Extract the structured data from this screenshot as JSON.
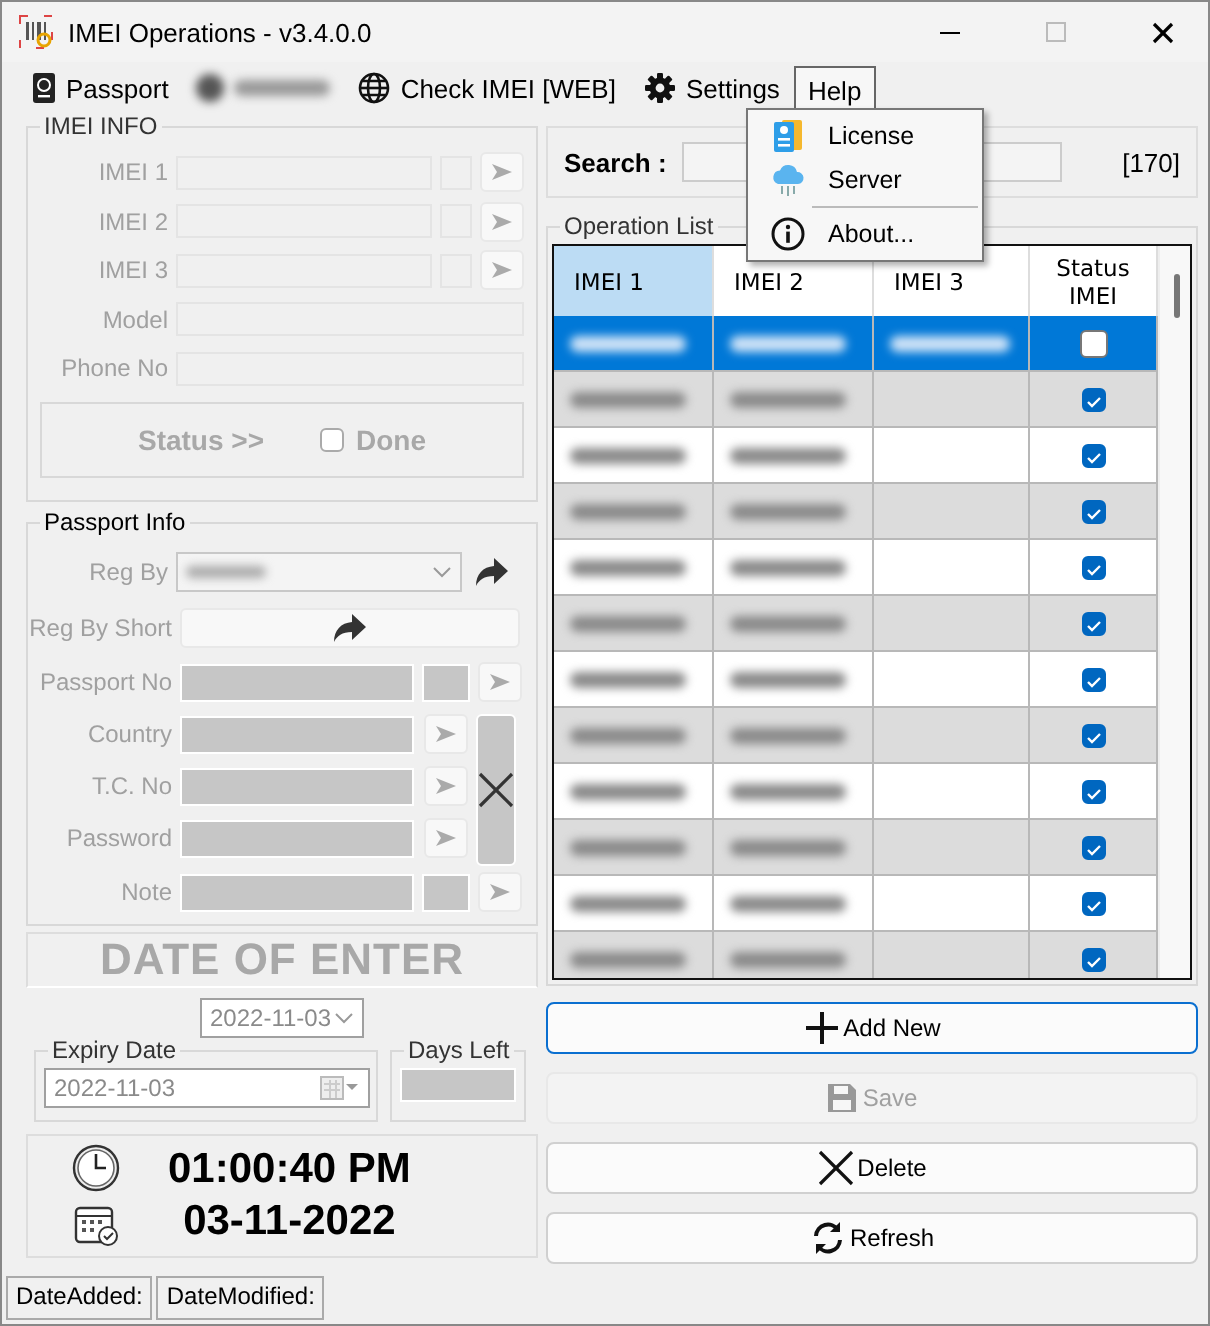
{
  "window": {
    "title": "IMEI Operations - v3.4.0.0"
  },
  "menu": [
    {
      "label": "Passport",
      "kind": "passport",
      "open": false
    },
    {
      "kind": "redacted",
      "open": false
    },
    {
      "label": "Check IMEI [WEB]",
      "kind": "globe",
      "open": false
    },
    {
      "label": "Settings",
      "kind": "gear",
      "open": false
    },
    {
      "label": "Help",
      "kind": "plain",
      "open": true
    }
  ],
  "help_menu": [
    {
      "label": "License",
      "kind": "license"
    },
    {
      "label": "Server",
      "kind": "cloud"
    },
    {
      "kind": "separator"
    },
    {
      "label": "About...",
      "kind": "info"
    }
  ],
  "imei_info": {
    "title": "IMEI INFO",
    "fields": [
      {
        "label": "IMEI 1",
        "kind": "imei"
      },
      {
        "label": "IMEI 2",
        "kind": "imei"
      },
      {
        "label": "IMEI 3",
        "kind": "imei"
      },
      {
        "label": "Model",
        "kind": "plain"
      },
      {
        "label": "Phone No",
        "kind": "plain"
      }
    ],
    "status_label": "Status >>",
    "done": {
      "label": "Done",
      "checked": false
    }
  },
  "passport_info": {
    "title": "Passport Info",
    "reg_by": {
      "label": "Reg By"
    },
    "reg_by_short": {
      "label": "Reg By Short"
    },
    "fields": [
      {
        "label": "Passport No",
        "kind": "split"
      },
      {
        "label": "Country",
        "kind": "clearable"
      },
      {
        "label": "T.C. No",
        "kind": "clearable"
      },
      {
        "label": "Password",
        "kind": "clearable"
      },
      {
        "label": "Note",
        "kind": "split"
      }
    ]
  },
  "date_of_enter": {
    "title": "DATE OF ENTER",
    "date": "2022-11-03"
  },
  "expiry_date": {
    "title": "Expiry Date",
    "date": "2022-11-03"
  },
  "days_left": {
    "title": "Days Left"
  },
  "clock": {
    "time": "01:00:40 PM",
    "date": "03-11-2022"
  },
  "search": {
    "label": "Search :",
    "count": "[170]"
  },
  "operation_list": {
    "title": "Operation List",
    "columns": [
      {
        "label": "IMEI 1",
        "selected": true
      },
      {
        "label": "IMEI 2",
        "selected": false
      },
      {
        "label": "IMEI 3",
        "selected": false
      },
      {
        "label": "Status IMEI",
        "selected": false
      }
    ],
    "rows": [
      {
        "selected": true,
        "has_imei_3": true,
        "checked": false
      },
      {
        "selected": false,
        "has_imei_3": false,
        "checked": true
      },
      {
        "selected": false,
        "has_imei_3": false,
        "checked": true
      },
      {
        "selected": false,
        "has_imei_3": false,
        "checked": true
      },
      {
        "selected": false,
        "has_imei_3": false,
        "checked": true
      },
      {
        "selected": false,
        "has_imei_3": false,
        "checked": true
      },
      {
        "selected": false,
        "has_imei_3": false,
        "checked": true
      },
      {
        "selected": false,
        "has_imei_3": false,
        "checked": true
      },
      {
        "selected": false,
        "has_imei_3": false,
        "checked": true
      },
      {
        "selected": false,
        "has_imei_3": false,
        "checked": true
      },
      {
        "selected": false,
        "has_imei_3": false,
        "checked": true
      },
      {
        "selected": false,
        "has_imei_3": false,
        "checked": true
      }
    ]
  },
  "buttons": [
    {
      "label": "Add New",
      "kind": "add",
      "focused": true,
      "disabled": false
    },
    {
      "label": "Save",
      "kind": "save",
      "focused": false,
      "disabled": true
    },
    {
      "label": "Delete",
      "kind": "delete",
      "focused": false,
      "disabled": false
    },
    {
      "label": "Refresh",
      "kind": "refresh",
      "focused": false,
      "disabled": false
    }
  ],
  "status_bar": [
    "DateAdded:",
    "DateModified:"
  ]
}
